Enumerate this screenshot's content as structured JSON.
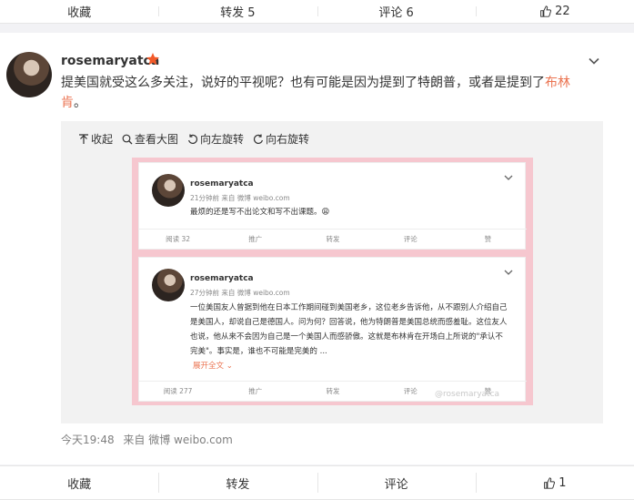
{
  "top_bar": {
    "favorite": "收藏",
    "repost": "转发 5",
    "comment": "评论 6",
    "like_count": "22"
  },
  "post": {
    "username": "rosemaryatca",
    "text_main": "提美国就受这么多关注，说好的平视呢？也有可能是因为提到了特朗普，或者是提到了",
    "text_highlight": "布林肯",
    "text_end": "。",
    "time": "今天19:48",
    "source": "来自 微博 weibo.com"
  },
  "media_toolbar": {
    "collapse": "收起",
    "view_large": "查看大图",
    "rotate_left": "向左旋转",
    "rotate_right": "向右旋转"
  },
  "screenshot": {
    "watermark": "@rosemaryatca",
    "posts": [
      {
        "username": "rosemaryatca",
        "meta": "21分钟前 来自 微博 weibo.com",
        "body": "最烦的还是写不出论文和写不出课题。😩",
        "reads": "阅读 32",
        "promote": "推广",
        "repost": "转发",
        "comment": "评论",
        "like": "赞"
      },
      {
        "username": "rosemaryatca",
        "meta": "27分钟前 来自 微博 weibo.com",
        "body": "一位美国友人曾据到他在日本工作期间碰到美国老乡，这位老乡告诉他，从不跟别人介绍自己是美国人，却说自己是德国人。问为何？回答说，他为特朗普是美国总统而感羞耻。这位友人也说，他从来不会因为自己是一个美国人而感骄傲。这就是布林肯在开场白上所说的\"承认不完美\"。事实是，谁也不可能是完美的 ...",
        "expand": "展开全文",
        "reads": "阅读 277",
        "promote": "推广",
        "repost": "转发",
        "comment": "评论",
        "like": "赞"
      }
    ]
  },
  "bottom_bar": {
    "favorite": "收藏",
    "repost": "转发",
    "comment": "评论",
    "like_count": "1"
  },
  "colors": {
    "accent": "#eb7350",
    "pink_frame": "#f6c7cf",
    "badge": "#f25a29"
  }
}
